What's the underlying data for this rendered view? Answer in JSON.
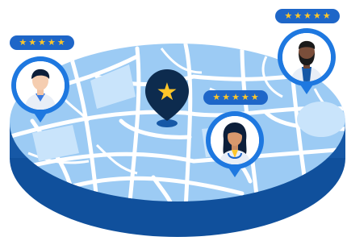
{
  "colors": {
    "map_land": "#9ccbf4",
    "map_roads": "#ffffff",
    "map_base": "#1658a6",
    "map_base_dark": "#0f4b94",
    "pin_blue": "#1e78e0",
    "badge_blue": "#1e66c8",
    "star_yellow": "#ffc629",
    "center_pin_dark": "#0d2b4e"
  },
  "icons": {
    "star": "★"
  },
  "providers": [
    {
      "name": "provider-left",
      "rating": 5,
      "icon": "doctor-man-avatar-icon"
    },
    {
      "name": "provider-center",
      "rating": 5,
      "icon": "doctor-woman-avatar-icon"
    },
    {
      "name": "provider-right",
      "rating": 5,
      "icon": "man-bearded-avatar-icon"
    }
  ],
  "center_pin": {
    "icon": "star-location-pin-icon"
  }
}
